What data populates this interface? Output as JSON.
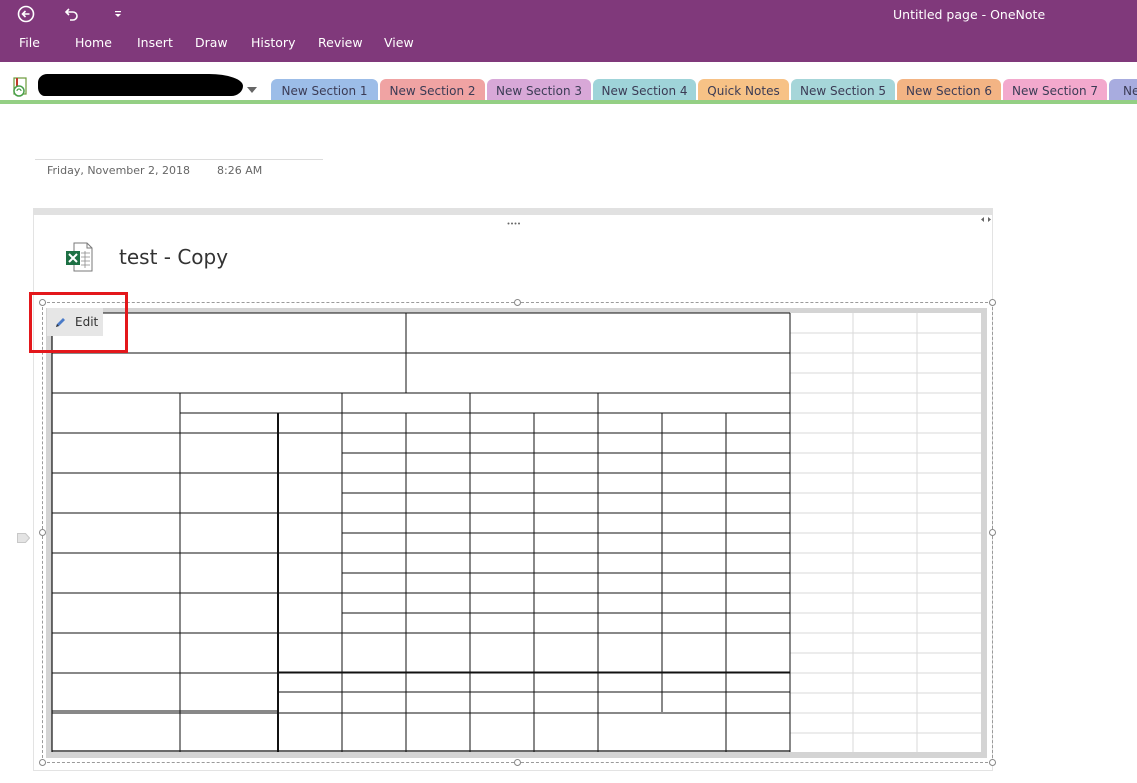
{
  "window": {
    "title": "Untitled page - OneNote"
  },
  "quick_access": {
    "back_icon": "back-arrow-icon",
    "undo_icon": "undo-icon",
    "customize_icon": "customize-dropdown-icon"
  },
  "ribbon": {
    "tabs": [
      "File",
      "Home",
      "Insert",
      "Draw",
      "History",
      "Review",
      "View"
    ]
  },
  "notebook": {
    "icon": "notebook-sync-icon",
    "dropdown_icon": "chevron-down-icon",
    "sections": [
      {
        "label": "New Section 1",
        "color": "#9cbde8"
      },
      {
        "label": "New Section 2",
        "color": "#f0a3a3"
      },
      {
        "label": "New Section 3",
        "color": "#d8a8d8"
      },
      {
        "label": "New Section 4",
        "color": "#9fd4d9"
      },
      {
        "label": "Quick Notes",
        "color": "#f7c286"
      },
      {
        "label": "New Section 5",
        "color": "#a6d6d9"
      },
      {
        "label": "New Section 6",
        "color": "#f3b484"
      },
      {
        "label": "New Section 7",
        "color": "#f3a9cd"
      },
      {
        "label": "Ne",
        "color": "#a8acdf"
      }
    ]
  },
  "page": {
    "date": "Friday, November 2, 2018",
    "time": "8:26 AM"
  },
  "embedded_file": {
    "icon": "excel-file-icon",
    "title": "test - Copy",
    "edit_label": "Edit",
    "edit_icon": "pencil-icon"
  },
  "colors": {
    "accent": "#80397b",
    "notebook_underline": "#94cf84",
    "highlight": "#e3171b"
  }
}
